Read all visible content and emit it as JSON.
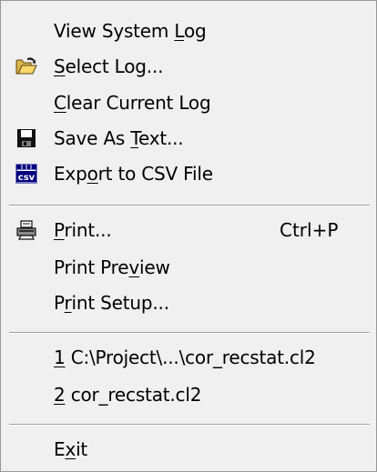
{
  "menu": {
    "items": [
      {
        "pre": "View System ",
        "u": "L",
        "post": "og"
      },
      {
        "pre": "",
        "u": "S",
        "post": "elect Log..."
      },
      {
        "pre": "",
        "u": "C",
        "post": "lear Current Log"
      },
      {
        "pre": "Save As ",
        "u": "T",
        "post": "ext..."
      },
      {
        "pre": "Exp",
        "u": "o",
        "post": "rt to CSV File"
      },
      {
        "pre": "",
        "u": "P",
        "post": "rint...",
        "shortcut": "Ctrl+P"
      },
      {
        "pre": "Print Pre",
        "u": "v",
        "post": "iew"
      },
      {
        "pre": "P",
        "u": "r",
        "post": "int Setup..."
      },
      {
        "pre": "",
        "u": "1",
        "post": " C:\\Project\\...\\cor_recstat.cl2"
      },
      {
        "pre": "",
        "u": "2",
        "post": " cor_recstat.cl2"
      },
      {
        "pre": "E",
        "u": "x",
        "post": "it"
      }
    ],
    "icons": {
      "select_log": "open-folder-icon",
      "save_as_text": "floppy-disk-icon",
      "export_csv": "csv-file-icon",
      "print": "printer-icon"
    },
    "csv_icon_text": "csv"
  }
}
